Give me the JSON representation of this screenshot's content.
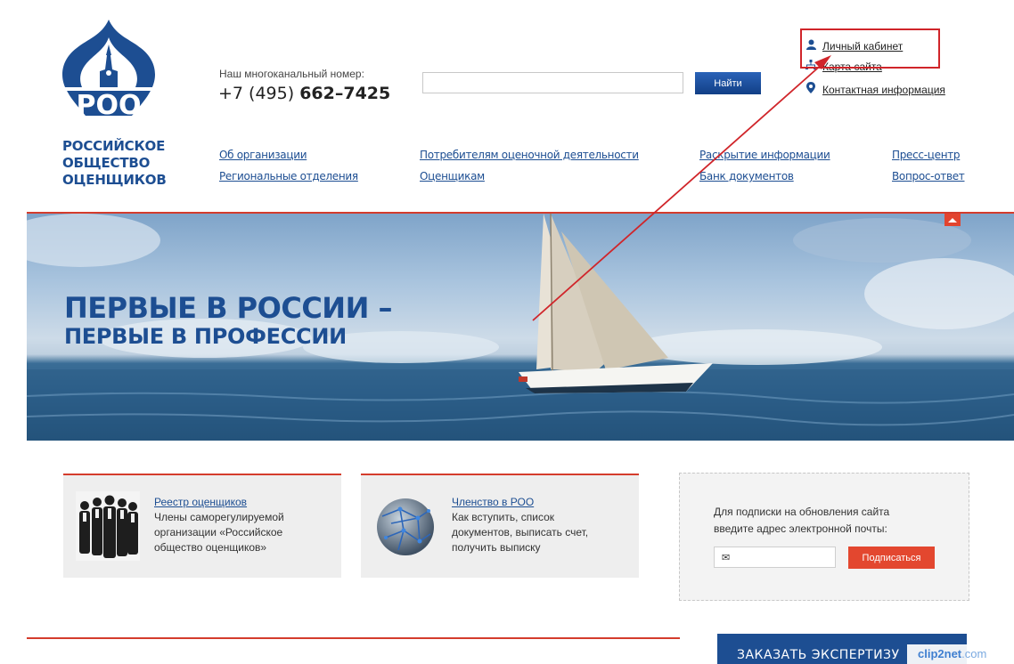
{
  "org": {
    "abbr": "РОО",
    "name_lines": [
      "РОССИЙСКОЕ",
      "ОБЩЕСТВО",
      "ОЦЕНЩИКОВ"
    ]
  },
  "phone": {
    "label": "Наш многоканальный номер:",
    "prefix": "+7 (495)",
    "number": "662–7425"
  },
  "search": {
    "placeholder": "",
    "button_label": "Найти"
  },
  "util_links": [
    {
      "label": "Личный кабинет",
      "icon": "user-icon"
    },
    {
      "label": "Карта сайта",
      "icon": "sitemap-icon"
    },
    {
      "label": "Контактная информация",
      "icon": "location-pin-icon"
    }
  ],
  "nav": [
    [
      "Об организации",
      "Региональные отделения"
    ],
    [
      "Потребителям оценочной деятельности",
      "Оценщикам"
    ],
    [
      "Раскрытие информации",
      "Банк документов"
    ],
    [
      "Пресс-центр",
      "Вопрос-ответ"
    ]
  ],
  "banner": {
    "line1": "ПЕРВЫЕ В РОССИИ –",
    "line2": "ПЕРВЫЕ В ПРОФЕССИИ"
  },
  "cards": [
    {
      "link": "Реестр оценщиков",
      "lines": [
        "Члены саморегулируемой",
        "организации «Российское",
        "общество оценщиков»"
      ],
      "image": "people-group-photo"
    },
    {
      "link": "Членство в РОО",
      "lines": [
        "Как вступить, список",
        "документов, выписать счет,",
        "получить выписку"
      ],
      "image": "globe-network-icon"
    }
  ],
  "subscribe": {
    "lines": [
      "Для подписки на обновления сайта",
      "введите адрес электронной почты:"
    ],
    "email_icon": "✉",
    "button_label": "Подписаться"
  },
  "order_button": "ЗАКАЗАТЬ ЭКСПЕРТИЗУ",
  "watermark": {
    "part1": "clip",
    "part2": "2",
    "part3": "net",
    "part4": ".com"
  },
  "colors": {
    "brand_blue": "#1d4e92",
    "accent_red": "#d43c2c",
    "button_orange": "#e3472f"
  }
}
